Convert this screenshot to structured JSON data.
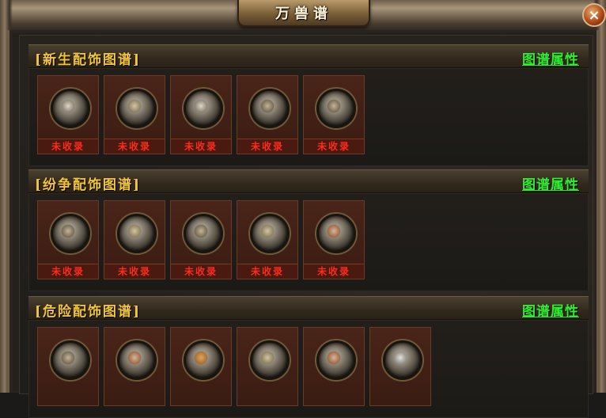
{
  "window": {
    "title": "万兽谱",
    "close_label": "×"
  },
  "sections": [
    {
      "title": "[新生配饰图谱]",
      "link": "图谱属性",
      "slots": [
        "未收录",
        "未收录",
        "未收录",
        "未收录",
        "未收录"
      ]
    },
    {
      "title": "[纷争配饰图谱]",
      "link": "图谱属性",
      "slots": [
        "未收录",
        "未收录",
        "未收录",
        "未收录",
        "未收录"
      ]
    },
    {
      "title": "[危险配饰图谱]",
      "link": "图谱属性",
      "slots": [
        "",
        "",
        "",
        "",
        "",
        ""
      ]
    }
  ],
  "colors": {
    "section_title": "#f2c53a",
    "link": "#2cf12c",
    "uncollected": "#ff2a1a"
  }
}
